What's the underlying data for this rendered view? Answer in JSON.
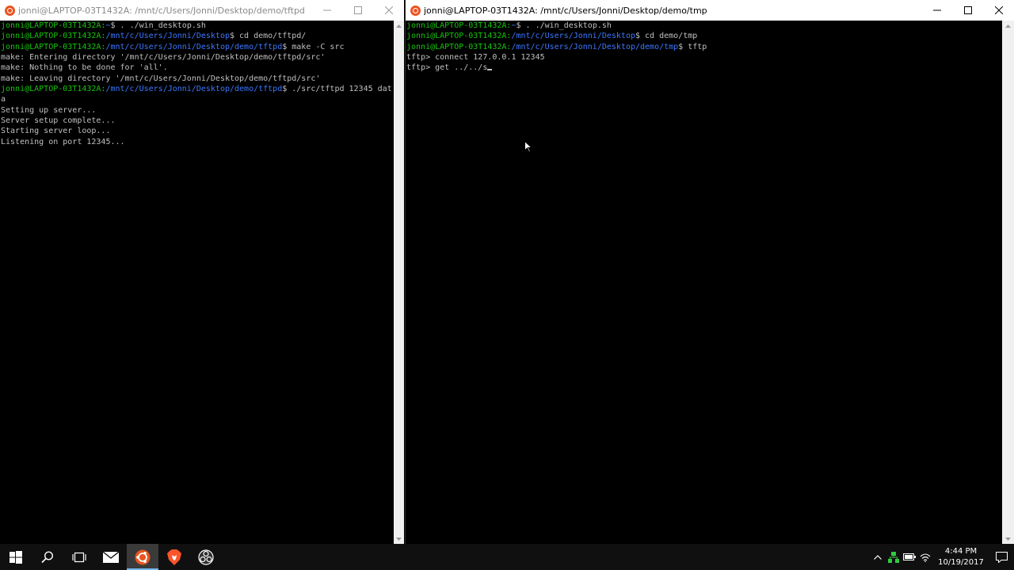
{
  "left_window": {
    "title": "jonni@LAPTOP-03T1432A: /mnt/c/Users/Jonni/Desktop/demo/tftpd",
    "lines": [
      {
        "user": "jonni@LAPTOP-03T1432A:",
        "path": "~",
        "cmd": "$ . ./win_desktop.sh"
      },
      {
        "user": "jonni@LAPTOP-03T1432A:",
        "path": "/mnt/c/Users/Jonni/Desktop",
        "cmd": "$ cd demo/tftpd/"
      },
      {
        "user": "jonni@LAPTOP-03T1432A:",
        "path": "/mnt/c/Users/Jonni/Desktop/demo/tftpd",
        "cmd": "$ make -C src"
      },
      {
        "text": "make: Entering directory '/mnt/c/Users/Jonni/Desktop/demo/tftpd/src'"
      },
      {
        "text": "make: Nothing to be done for 'all'."
      },
      {
        "text": "make: Leaving directory '/mnt/c/Users/Jonni/Desktop/demo/tftpd/src'"
      },
      {
        "user": "jonni@LAPTOP-03T1432A:",
        "path": "/mnt/c/Users/Jonni/Desktop/demo/tftpd",
        "cmd": "$ ./src/tftpd 12345 dat"
      },
      {
        "text": "a"
      },
      {
        "text": "Setting up server..."
      },
      {
        "text": "Server setup complete..."
      },
      {
        "text": "Starting server loop..."
      },
      {
        "text": "Listening on port 12345..."
      }
    ]
  },
  "right_window": {
    "title": "jonni@LAPTOP-03T1432A: /mnt/c/Users/Jonni/Desktop/demo/tmp",
    "lines": [
      {
        "user": "jonni@LAPTOP-03T1432A:",
        "path": "~",
        "cmd": "$ . ./win_desktop.sh"
      },
      {
        "user": "jonni@LAPTOP-03T1432A:",
        "path": "/mnt/c/Users/Jonni/Desktop",
        "cmd": "$ cd demo/tmp"
      },
      {
        "user": "jonni@LAPTOP-03T1432A:",
        "path": "/mnt/c/Users/Jonni/Desktop/demo/tmp",
        "cmd": "$ tftp"
      },
      {
        "text": "tftp> connect 127.0.0.1 12345"
      },
      {
        "text": "tftp> get ../../s",
        "cursor": true
      }
    ]
  },
  "taskbar": {
    "apps": [
      {
        "name": "start-button",
        "icon": "windows-logo-icon",
        "active": false
      },
      {
        "name": "search-button",
        "icon": "search-icon",
        "active": false
      },
      {
        "name": "task-view-button",
        "icon": "task-view-icon",
        "active": false
      },
      {
        "name": "taskbar-app-mail",
        "icon": "mail-icon",
        "active": false
      },
      {
        "name": "taskbar-app-ubuntu",
        "icon": "ubuntu-icon",
        "active": true
      },
      {
        "name": "taskbar-app-brave",
        "icon": "brave-lion-icon",
        "active": false
      },
      {
        "name": "taskbar-app-obs",
        "icon": "obs-icon",
        "active": false
      }
    ],
    "clock": {
      "time": "4:44 PM",
      "date": "10/19/2017"
    }
  },
  "colors": {
    "prompt_user": "#16c60c",
    "prompt_path": "#3b78ff",
    "text": "#c0c0c0",
    "accent": "#76b9ed",
    "ubuntu": "#e95420"
  }
}
